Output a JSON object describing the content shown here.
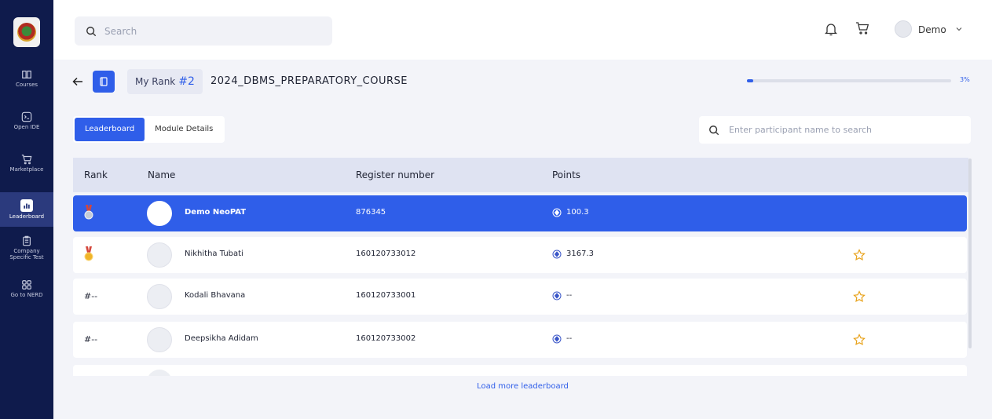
{
  "sidebar": {
    "items": [
      {
        "label": "Courses",
        "icon": "book-icon"
      },
      {
        "label": "Open IDE",
        "icon": "terminal-icon"
      },
      {
        "label": "Marketplace",
        "icon": "cart-icon"
      },
      {
        "label": "Leaderboard",
        "icon": "chart-icon",
        "active": true
      },
      {
        "label": "Company Specific Test",
        "icon": "clipboard-icon"
      },
      {
        "label": "Go to NERD",
        "icon": "grid-icon"
      }
    ]
  },
  "topbar": {
    "search_placeholder": "Search",
    "user_name": "Demo"
  },
  "course": {
    "rank_label": "My Rank",
    "rank_value": "#2",
    "title": "2024_DBMS_PREPARATORY_COURSE",
    "progress_percent": 3,
    "progress_text": "3%"
  },
  "tabs": [
    {
      "label": "Leaderboard",
      "active": true
    },
    {
      "label": "Module Details",
      "active": false
    }
  ],
  "participant_search": {
    "placeholder": "Enter participant name to search"
  },
  "table": {
    "headers": [
      "Rank",
      "Name",
      "Register number",
      "Points"
    ],
    "rows": [
      {
        "rank": "",
        "rank_type": "medal-silver",
        "name": "Demo NeoPAT",
        "register": "876345",
        "points": "100.3",
        "highlight": true,
        "starred": false
      },
      {
        "rank": "",
        "rank_type": "medal-gold",
        "name": "Nikhitha Tubati",
        "register": "160120733012",
        "points": "3167.3",
        "highlight": false,
        "starred": true
      },
      {
        "rank": "#--",
        "rank_type": "text",
        "name": "Kodali Bhavana",
        "register": "160120733001",
        "points": "--",
        "highlight": false,
        "starred": true
      },
      {
        "rank": "#--",
        "rank_type": "text",
        "name": "Deepsikha Adidam",
        "register": "160120733002",
        "points": "--",
        "highlight": false,
        "starred": true
      }
    ]
  },
  "load_more_label": "Load more leaderboard",
  "colors": {
    "sidebar": "#0f1b4c",
    "accent": "#2f5ee9",
    "gold": "#e8a21a",
    "silver": "#aeb6c4"
  }
}
